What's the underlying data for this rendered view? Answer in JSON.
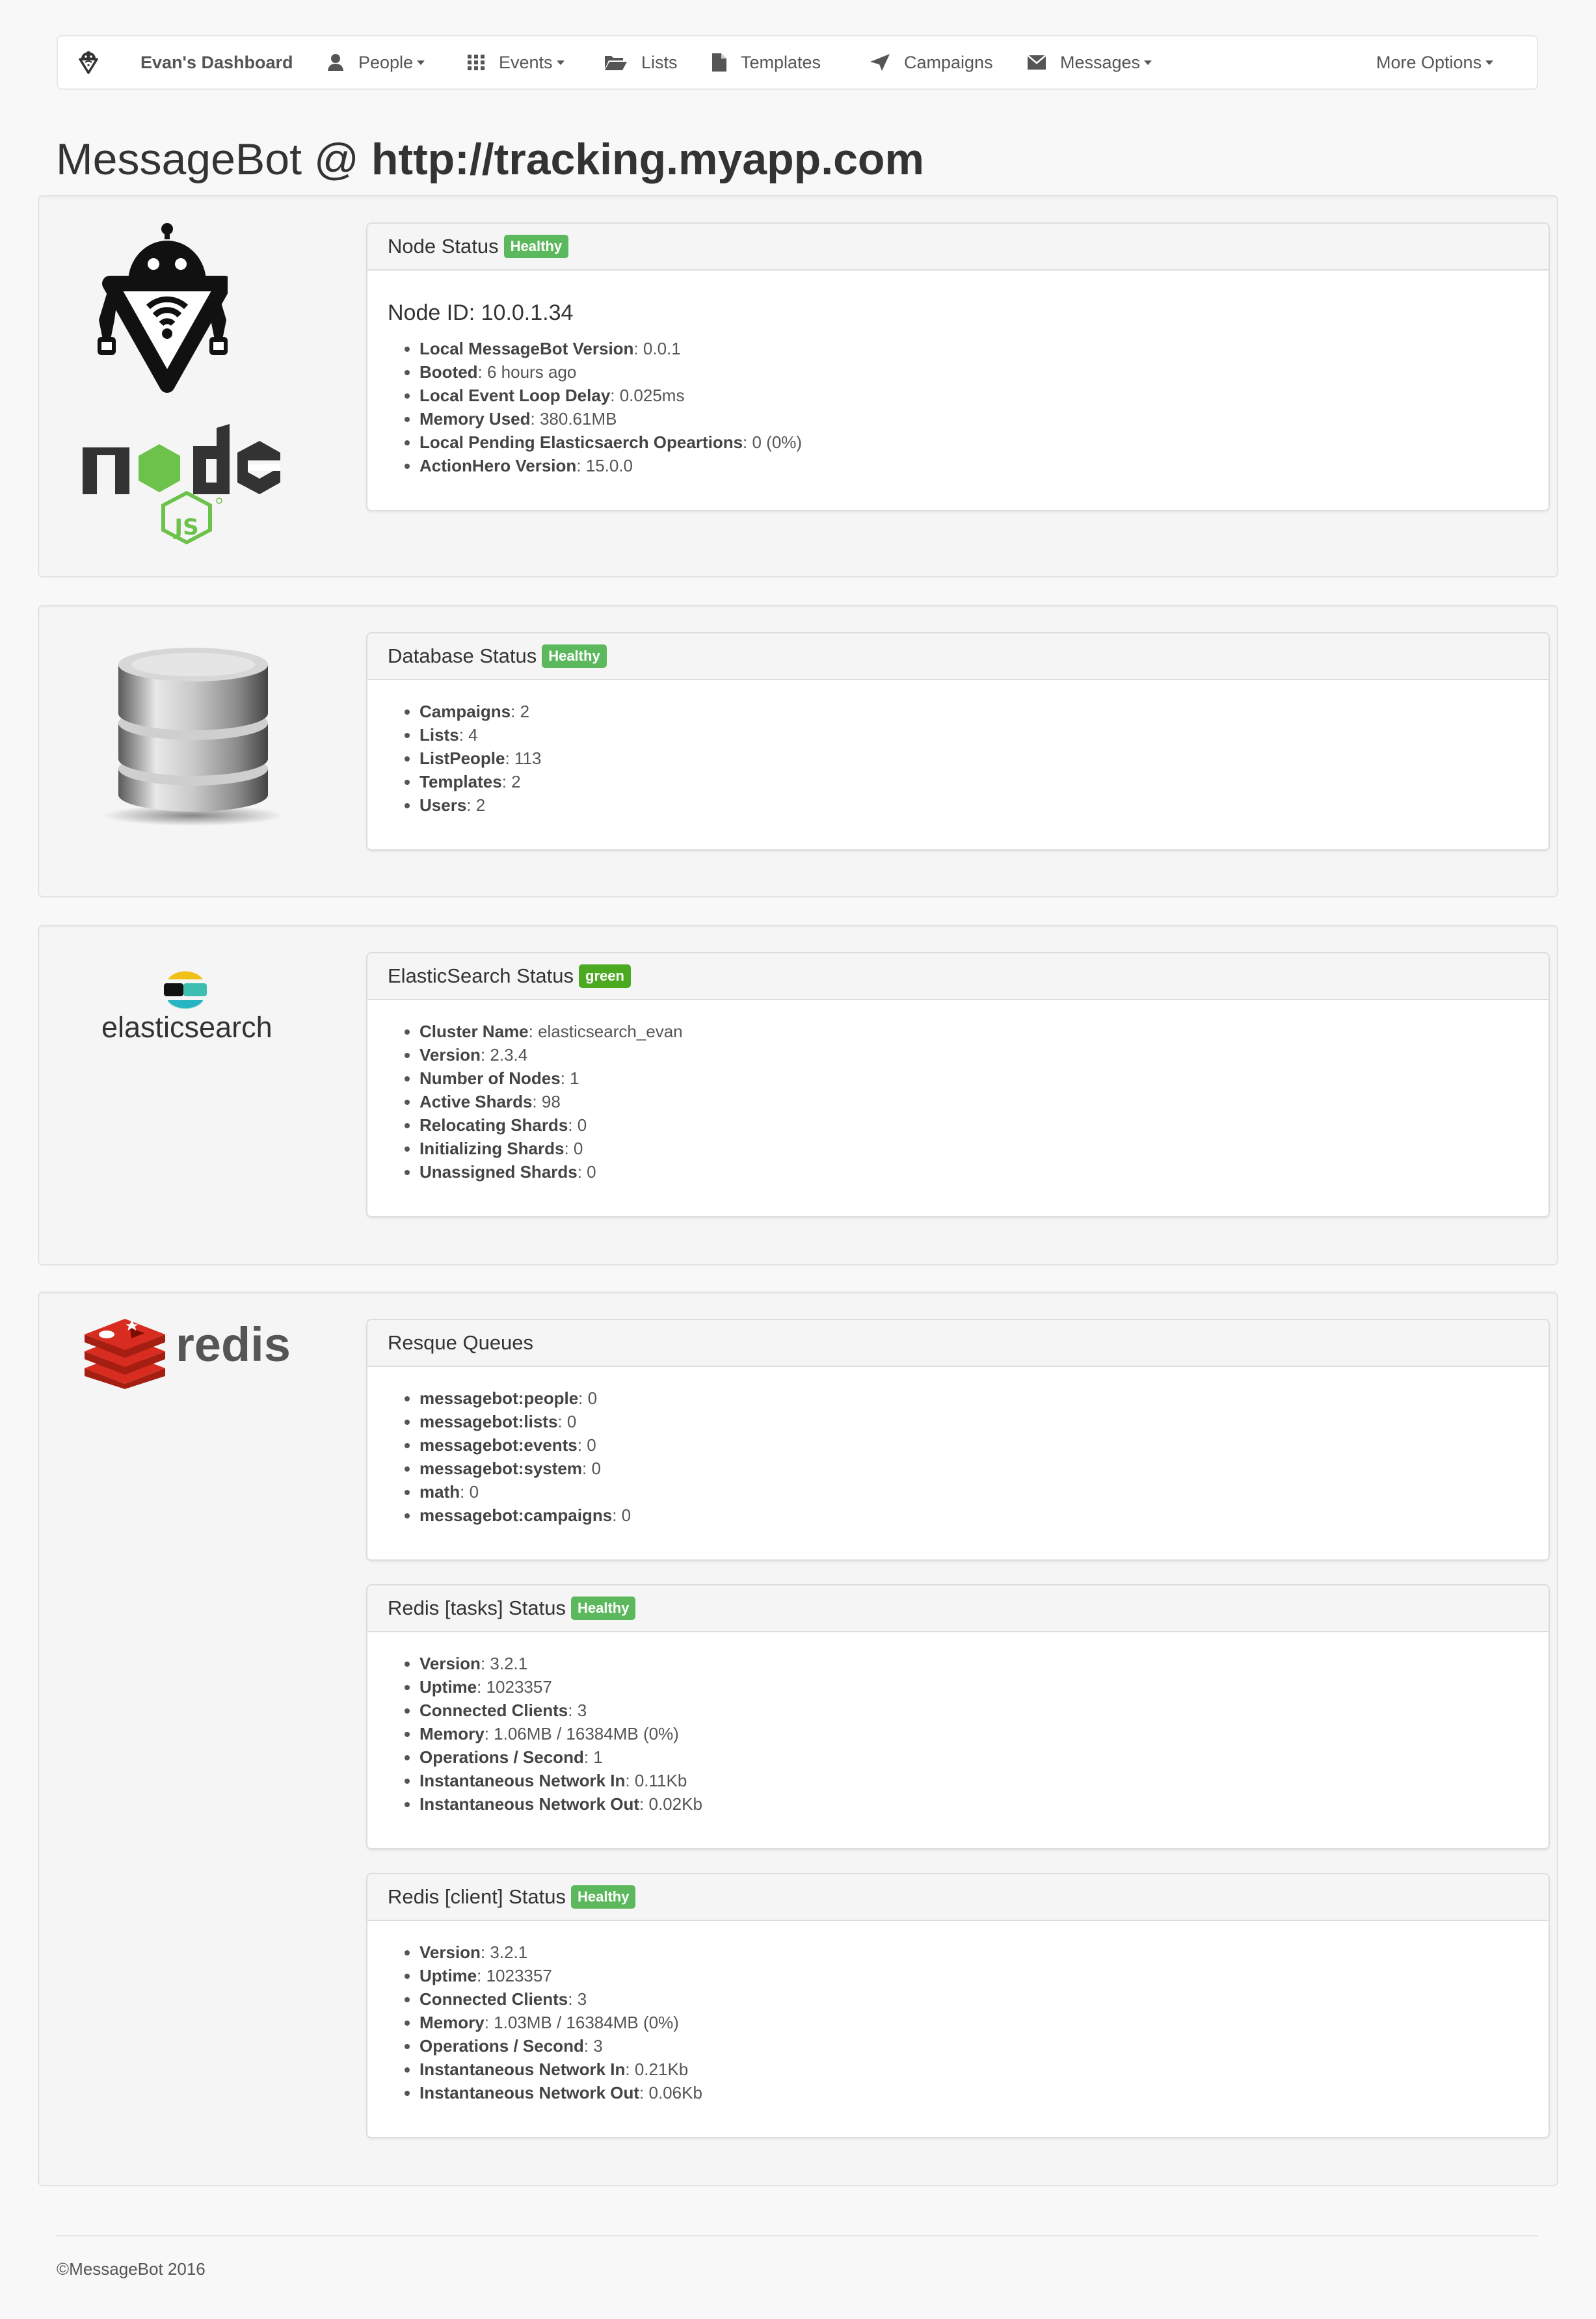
{
  "nav": {
    "brand_title": "Evan's Dashboard",
    "items": [
      {
        "label": "People",
        "icon": "user-icon",
        "dropdown": true
      },
      {
        "label": "Events",
        "icon": "grid-icon",
        "dropdown": true
      },
      {
        "label": "Lists",
        "icon": "folder-open-icon",
        "dropdown": false
      },
      {
        "label": "Templates",
        "icon": "file-icon",
        "dropdown": false
      },
      {
        "label": "Campaigns",
        "icon": "send-icon",
        "dropdown": false
      },
      {
        "label": "Messages",
        "icon": "envelope-icon",
        "dropdown": true
      }
    ],
    "more_options": "More Options"
  },
  "page": {
    "title_prefix": "MessageBot @ ",
    "title_host": "http://tracking.myapp.com"
  },
  "node": {
    "heading": "Node Status",
    "badge": "Healthy",
    "node_id": "Node ID: 10.0.1.34",
    "items": [
      {
        "key": "Local MessageBot Version",
        "value": ": 0.0.1"
      },
      {
        "key": "Booted",
        "value": ": 6 hours ago"
      },
      {
        "key": "Local Event Loop Delay",
        "value": ": 0.025ms"
      },
      {
        "key": "Memory Used",
        "value": ": 380.61MB"
      },
      {
        "key": "Local Pending Elasticsaerch Opeartions",
        "value": ": 0 (0%)"
      },
      {
        "key": "ActionHero Version",
        "value": ": 15.0.0"
      }
    ],
    "logo_text": "node",
    "logo_sub": "JS"
  },
  "database": {
    "heading": "Database Status",
    "badge": "Healthy",
    "items": [
      {
        "key": "Campaigns",
        "value": ": 2"
      },
      {
        "key": "Lists",
        "value": ": 4"
      },
      {
        "key": "ListPeople",
        "value": ": 113"
      },
      {
        "key": "Templates",
        "value": ": 2"
      },
      {
        "key": "Users",
        "value": ": 2"
      }
    ]
  },
  "elasticsearch": {
    "heading": "ElasticSearch Status",
    "badge": "green",
    "logo_text": "elasticsearch",
    "items": [
      {
        "key": "Cluster Name",
        "value": ": elasticsearch_evan"
      },
      {
        "key": "Version",
        "value": ": 2.3.4"
      },
      {
        "key": "Number of Nodes",
        "value": ": 1"
      },
      {
        "key": "Active Shards",
        "value": ": 98"
      },
      {
        "key": "Relocating Shards",
        "value": ": 0"
      },
      {
        "key": "Initializing Shards",
        "value": ": 0"
      },
      {
        "key": "Unassigned Shards",
        "value": ": 0"
      }
    ]
  },
  "redis": {
    "logo_text": "redis",
    "queues": {
      "heading": "Resque Queues",
      "items": [
        {
          "key": "messagebot:people",
          "value": ": 0"
        },
        {
          "key": "messagebot:lists",
          "value": ": 0"
        },
        {
          "key": "messagebot:events",
          "value": ": 0"
        },
        {
          "key": "messagebot:system",
          "value": ": 0"
        },
        {
          "key": "math",
          "value": ": 0"
        },
        {
          "key": "messagebot:campaigns",
          "value": ": 0"
        }
      ]
    },
    "tasks": {
      "heading": "Redis [tasks] Status",
      "badge": "Healthy",
      "items": [
        {
          "key": "Version",
          "value": ": 3.2.1"
        },
        {
          "key": "Uptime",
          "value": ": 1023357"
        },
        {
          "key": "Connected Clients",
          "value": ": 3"
        },
        {
          "key": "Memory",
          "value": ": 1.06MB / 16384MB (0%)"
        },
        {
          "key": "Operations / Second",
          "value": ": 1"
        },
        {
          "key": "Instantaneous Network In",
          "value": ": 0.11Kb"
        },
        {
          "key": "Instantaneous Network Out",
          "value": ": 0.02Kb"
        }
      ]
    },
    "client": {
      "heading": "Redis [client] Status",
      "badge": "Healthy",
      "items": [
        {
          "key": "Version",
          "value": ": 3.2.1"
        },
        {
          "key": "Uptime",
          "value": ": 1023357"
        },
        {
          "key": "Connected Clients",
          "value": ": 3"
        },
        {
          "key": "Memory",
          "value": ": 1.03MB / 16384MB (0%)"
        },
        {
          "key": "Operations / Second",
          "value": ": 3"
        },
        {
          "key": "Instantaneous Network In",
          "value": ": 0.21Kb"
        },
        {
          "key": "Instantaneous Network Out",
          "value": ": 0.06Kb"
        }
      ]
    }
  },
  "footer": {
    "text": "©MessageBot 2016"
  },
  "colors": {
    "healthy_badge": "#5cb85c",
    "green_badge": "#4caa21",
    "redis_red": "#d82c20",
    "node_green": "#6cc24a"
  }
}
